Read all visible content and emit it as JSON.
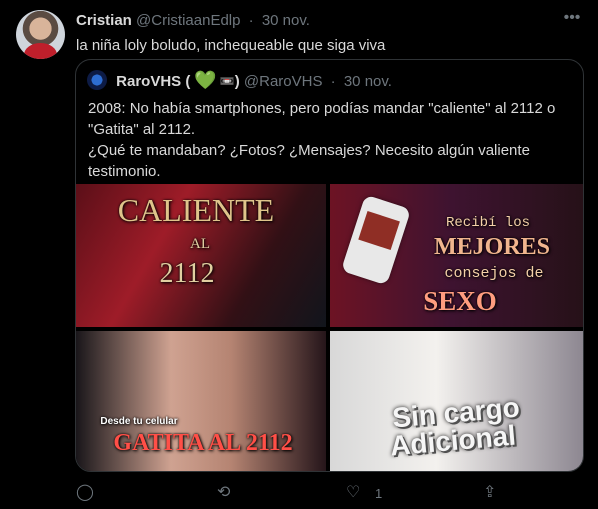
{
  "tweet": {
    "author": "Cristian",
    "handle": "@CristiaanEdlp",
    "date": "30 nov.",
    "text": "la niña loly boludo, inchequeable que siga viva",
    "likes": "1"
  },
  "quote": {
    "author": "RaroVHS (",
    "author_end": ")",
    "heart": "💚",
    "recording_badge": "📼",
    "handle": "@RaroVHS",
    "date": "30 nov.",
    "text_lines": [
      "2008: No había smartphones, pero podías mandar \"caliente\" al 2112 o",
      "\"Gatita\" al 2112.",
      "¿Qué te mandaban? ¿Fotos? ¿Mensajes? Necesito algún valiente",
      "testimonio."
    ]
  },
  "media": {
    "tile1": {
      "top": "CALIENTE",
      "middle": "AL",
      "bottom": "2112"
    },
    "tile2": {
      "line1": "Recibí los",
      "line2": "MEJORES",
      "line3": "consejos de",
      "line4": "SEXO"
    },
    "tile3": {
      "small": "Desde tu celular",
      "big": "GATITA AL 2112"
    },
    "tile4": {
      "line1": "Sin cargo",
      "line2": "Adicional"
    }
  },
  "icons": {
    "more": "more-icon",
    "reply": "reply-icon",
    "retweet": "retweet-icon",
    "like": "heart-icon",
    "share": "share-icon"
  }
}
